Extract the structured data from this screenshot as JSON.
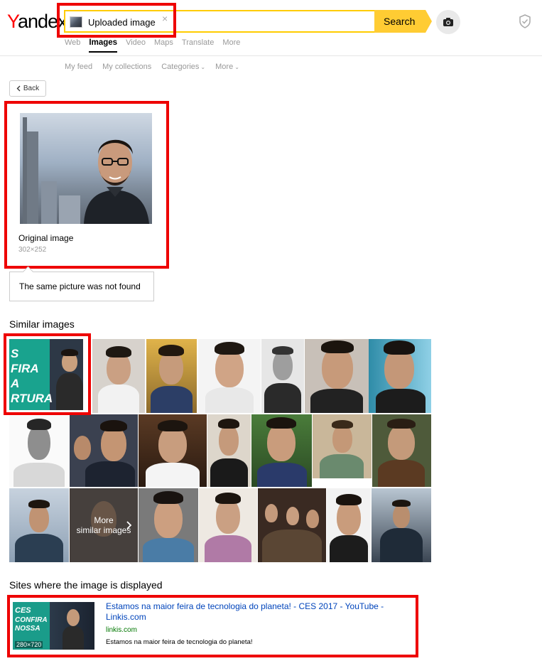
{
  "logo": {
    "first": "Y",
    "rest": "andex"
  },
  "search": {
    "chip_label": "Uploaded image",
    "clear": "×",
    "button": "Search"
  },
  "tabs": [
    "Web",
    "Images",
    "Video",
    "Maps",
    "Translate",
    "More"
  ],
  "subnav": [
    "My feed",
    "My collections",
    "Categories",
    "More"
  ],
  "back": "Back",
  "original": {
    "title": "Original image",
    "size": "302×252"
  },
  "not_found": "The same picture was not found",
  "similar": {
    "title": "Similar images",
    "more": "More\nsimilar images",
    "first_tile_text": [
      "S",
      "FIRA",
      "A",
      "RTURA"
    ]
  },
  "sites": {
    "title": "Sites where the image is displayed",
    "items": [
      {
        "title": "Estamos na maior feira de tecnologia do planeta! - CES 2017 - YouTube - Linkis.com",
        "domain": "linkis.com",
        "description": "Estamos na maior feira de tecnologia do planeta!",
        "thumb_text": [
          "CES",
          "CONFIRA",
          "NOSSA"
        ],
        "thumb_size": "280×720"
      }
    ]
  },
  "colors": {
    "accent": "#ffcc33",
    "highlight": "#ee0000",
    "link": "#0044bb",
    "domain": "#007700"
  }
}
